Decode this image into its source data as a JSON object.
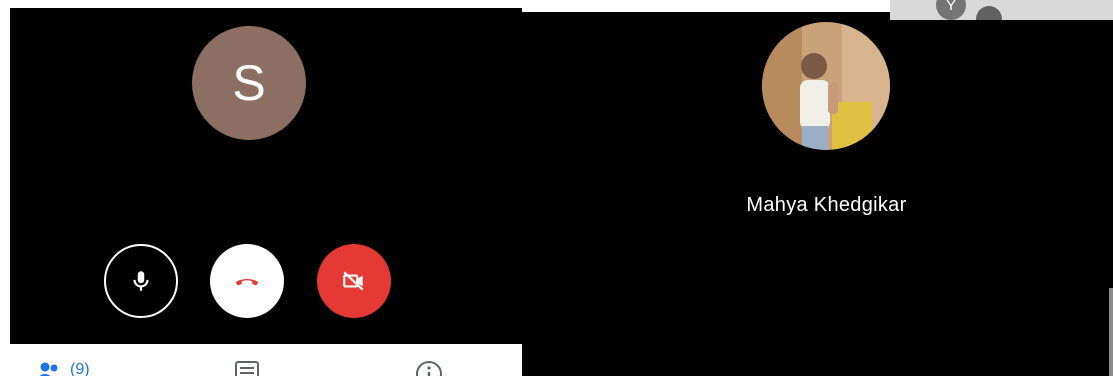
{
  "left_tile": {
    "avatar_initial": "S",
    "avatar_color": "#8d6e63"
  },
  "controls": {
    "mic": {
      "icon": "microphone-icon",
      "state": "on"
    },
    "end_call": {
      "icon": "hang-up-icon",
      "color": "#e53935"
    },
    "camera": {
      "icon": "camera-off-icon",
      "state": "off",
      "color": "#e53935"
    }
  },
  "bottom_tabs": {
    "people": {
      "icon": "people-icon",
      "count": "(9)"
    },
    "chat": {
      "icon": "chat-icon"
    },
    "info": {
      "icon": "info-icon"
    }
  },
  "participant": {
    "name": "Mahya Khedgikar",
    "avatar": "profile-photo"
  },
  "self_preview": {
    "avatar_initial": "Y"
  },
  "colors": {
    "accent": "#1a73e8",
    "danger": "#e53935",
    "background": "#000000"
  }
}
